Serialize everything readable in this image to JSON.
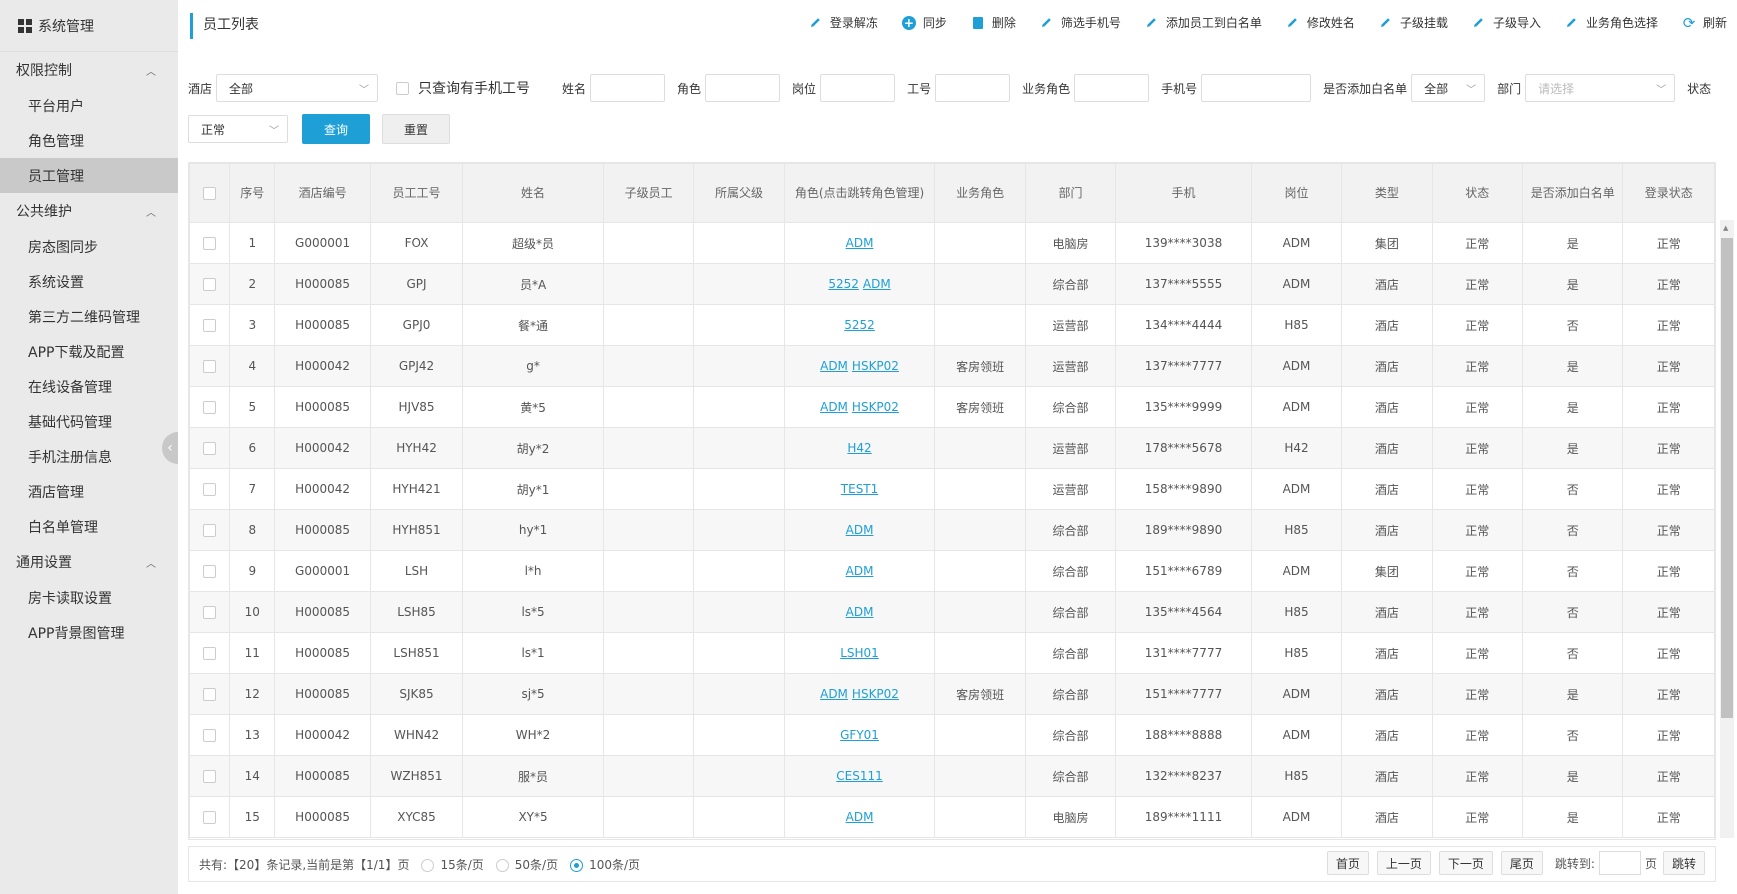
{
  "sidebar": {
    "header": "系统管理",
    "groups": [
      {
        "label": "权限控制",
        "items": [
          "平台用户",
          "角色管理",
          "员工管理"
        ]
      },
      {
        "label": "公共维护",
        "items": [
          "房态图同步",
          "系统设置",
          "第三方二维码管理",
          "APP下载及配置",
          "在线设备管理",
          "基础代码管理",
          "手机注册信息",
          "酒店管理",
          "白名单管理"
        ]
      },
      {
        "label": "通用设置",
        "items": [
          "房卡读取设置",
          "APP背景图管理"
        ]
      }
    ],
    "active_item": "员工管理"
  },
  "page_title": "员工列表",
  "toolbar": [
    {
      "label": "登录解冻",
      "icon": "pencil-icon"
    },
    {
      "label": "同步",
      "icon": "plus-circle-icon"
    },
    {
      "label": "删除",
      "icon": "trash-icon"
    },
    {
      "label": "筛选手机号",
      "icon": "pencil-icon"
    },
    {
      "label": "添加员工到白名单",
      "icon": "pencil-icon"
    },
    {
      "label": "修改姓名",
      "icon": "pencil-icon"
    },
    {
      "label": "子级挂载",
      "icon": "pencil-icon"
    },
    {
      "label": "子级导入",
      "icon": "pencil-icon"
    },
    {
      "label": "业务角色选择",
      "icon": "pencil-icon"
    },
    {
      "label": "刷新",
      "icon": "refresh-icon"
    }
  ],
  "filters": {
    "hotel_label": "酒店",
    "hotel_value": "全部",
    "phone_only_label": "只查询有手机工号",
    "name_label": "姓名",
    "role_label": "角色",
    "post_label": "岗位",
    "empno_label": "工号",
    "bizrole_label": "业务角色",
    "mobile_label": "手机号",
    "whitelist_label": "是否添加白名单",
    "whitelist_value": "全部",
    "dept_label": "部门",
    "dept_placeholder": "请选择",
    "status_label": "状态",
    "status_value": "正常",
    "query_button": "查询",
    "reset_button": "重置"
  },
  "table": {
    "headers": [
      "序号",
      "酒店编号",
      "员工工号",
      "姓名",
      "子级员工",
      "所属父级",
      "角色(点击跳转角色管理)",
      "业务角色",
      "部门",
      "手机",
      "岗位",
      "类型",
      "状态",
      "是否添加白名单",
      "登录状态"
    ],
    "rows": [
      {
        "no": "1",
        "hotel": "G000001",
        "empno": "FOX",
        "name": "超级*员",
        "child": "",
        "parent": "",
        "roles": [
          "ADM"
        ],
        "biz": "",
        "dept": "电脑房",
        "mobile": "139****3038",
        "post": "ADM",
        "type": "集团",
        "status": "正常",
        "whitelist": "是",
        "login": "正常"
      },
      {
        "no": "2",
        "hotel": "H000085",
        "empno": "GPJ",
        "name": "员*A",
        "child": "",
        "parent": "",
        "roles": [
          "5252",
          "ADM"
        ],
        "biz": "",
        "dept": "综合部",
        "mobile": "137****5555",
        "post": "ADM",
        "type": "酒店",
        "status": "正常",
        "whitelist": "是",
        "login": "正常"
      },
      {
        "no": "3",
        "hotel": "H000085",
        "empno": "GPJ0",
        "name": "餐*通",
        "child": "",
        "parent": "",
        "roles": [
          "5252"
        ],
        "biz": "",
        "dept": "运营部",
        "mobile": "134****4444",
        "post": "H85",
        "type": "酒店",
        "status": "正常",
        "whitelist": "否",
        "login": "正常"
      },
      {
        "no": "4",
        "hotel": "H000042",
        "empno": "GPJ42",
        "name": "g*",
        "child": "",
        "parent": "",
        "roles": [
          "ADM",
          "HSKP02"
        ],
        "biz": "客房领班",
        "dept": "运营部",
        "mobile": "137****7777",
        "post": "ADM",
        "type": "酒店",
        "status": "正常",
        "whitelist": "是",
        "login": "正常"
      },
      {
        "no": "5",
        "hotel": "H000085",
        "empno": "HJV85",
        "name": "黄*5",
        "child": "",
        "parent": "",
        "roles": [
          "ADM",
          "HSKP02"
        ],
        "biz": "客房领班",
        "dept": "综合部",
        "mobile": "135****9999",
        "post": "ADM",
        "type": "酒店",
        "status": "正常",
        "whitelist": "是",
        "login": "正常"
      },
      {
        "no": "6",
        "hotel": "H000042",
        "empno": "HYH42",
        "name": "胡y*2",
        "child": "",
        "parent": "",
        "roles": [
          "H42"
        ],
        "biz": "",
        "dept": "运营部",
        "mobile": "178****5678",
        "post": "H42",
        "type": "酒店",
        "status": "正常",
        "whitelist": "是",
        "login": "正常"
      },
      {
        "no": "7",
        "hotel": "H000042",
        "empno": "HYH421",
        "name": "胡y*1",
        "child": "",
        "parent": "",
        "roles": [
          "TEST1"
        ],
        "biz": "",
        "dept": "运营部",
        "mobile": "158****9890",
        "post": "ADM",
        "type": "酒店",
        "status": "正常",
        "whitelist": "否",
        "login": "正常"
      },
      {
        "no": "8",
        "hotel": "H000085",
        "empno": "HYH851",
        "name": "hy*1",
        "child": "",
        "parent": "",
        "roles": [
          "ADM"
        ],
        "biz": "",
        "dept": "综合部",
        "mobile": "189****9890",
        "post": "H85",
        "type": "酒店",
        "status": "正常",
        "whitelist": "否",
        "login": "正常"
      },
      {
        "no": "9",
        "hotel": "G000001",
        "empno": "LSH",
        "name": "l*h",
        "child": "",
        "parent": "",
        "roles": [
          "ADM"
        ],
        "biz": "",
        "dept": "综合部",
        "mobile": "151****6789",
        "post": "ADM",
        "type": "集团",
        "status": "正常",
        "whitelist": "否",
        "login": "正常"
      },
      {
        "no": "10",
        "hotel": "H000085",
        "empno": "LSH85",
        "name": "ls*5",
        "child": "",
        "parent": "",
        "roles": [
          "ADM"
        ],
        "biz": "",
        "dept": "综合部",
        "mobile": "135****4564",
        "post": "H85",
        "type": "酒店",
        "status": "正常",
        "whitelist": "否",
        "login": "正常"
      },
      {
        "no": "11",
        "hotel": "H000085",
        "empno": "LSH851",
        "name": "ls*1",
        "child": "",
        "parent": "",
        "roles": [
          "LSH01"
        ],
        "biz": "",
        "dept": "综合部",
        "mobile": "131****7777",
        "post": "H85",
        "type": "酒店",
        "status": "正常",
        "whitelist": "否",
        "login": "正常"
      },
      {
        "no": "12",
        "hotel": "H000085",
        "empno": "SJK85",
        "name": "sj*5",
        "child": "",
        "parent": "",
        "roles": [
          "ADM",
          "HSKP02"
        ],
        "biz": "客房领班",
        "dept": "综合部",
        "mobile": "151****7777",
        "post": "ADM",
        "type": "酒店",
        "status": "正常",
        "whitelist": "是",
        "login": "正常"
      },
      {
        "no": "13",
        "hotel": "H000042",
        "empno": "WHN42",
        "name": "WH*2",
        "child": "",
        "parent": "",
        "roles": [
          "GFY01"
        ],
        "biz": "",
        "dept": "综合部",
        "mobile": "188****8888",
        "post": "ADM",
        "type": "酒店",
        "status": "正常",
        "whitelist": "否",
        "login": "正常"
      },
      {
        "no": "14",
        "hotel": "H000085",
        "empno": "WZH851",
        "name": "服*员",
        "child": "",
        "parent": "",
        "roles": [
          "CES111"
        ],
        "biz": "",
        "dept": "综合部",
        "mobile": "132****8237",
        "post": "H85",
        "type": "酒店",
        "status": "正常",
        "whitelist": "是",
        "login": "正常"
      },
      {
        "no": "15",
        "hotel": "H000085",
        "empno": "XYC85",
        "name": "XY*5",
        "child": "",
        "parent": "",
        "roles": [
          "ADM"
        ],
        "biz": "",
        "dept": "电脑房",
        "mobile": "189****1111",
        "post": "ADM",
        "type": "酒店",
        "status": "正常",
        "whitelist": "是",
        "login": "正常"
      }
    ]
  },
  "footer": {
    "summary": "共有:【20】条记录,当前是第【1/1】页",
    "page_sizes": [
      "15条/页",
      "50条/页",
      "100条/页"
    ],
    "selected_page_size": "100条/页",
    "first": "首页",
    "prev": "上一页",
    "next": "下一页",
    "last": "尾页",
    "jump_label": "跳转到:",
    "page_unit": "页",
    "jump_button": "跳转"
  },
  "colors": {
    "accent": "#1e9fd6",
    "sidebar_bg": "#eaeaea",
    "sidebar_active": "#c9c9c9"
  }
}
